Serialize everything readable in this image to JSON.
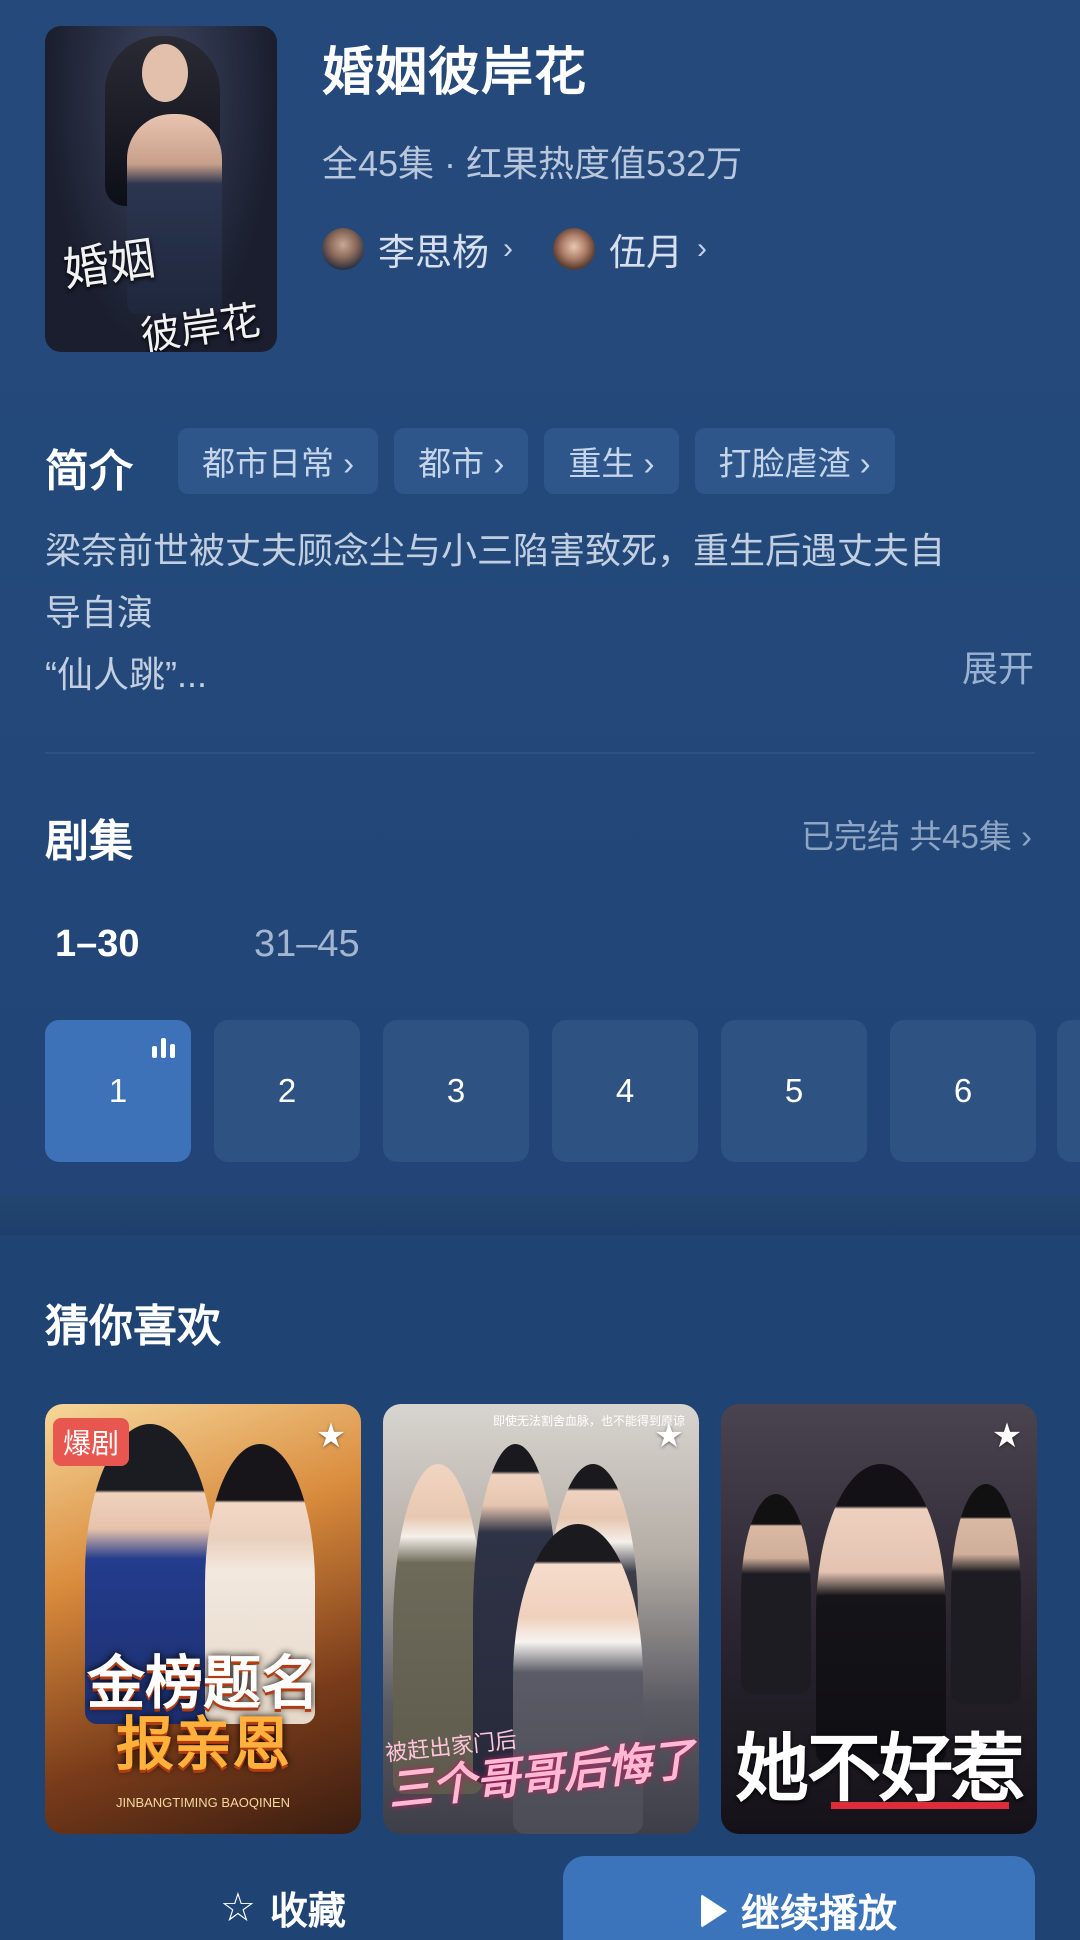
{
  "show": {
    "title": "婚姻彼岸花",
    "meta": "全45集 · 红果热度值532万",
    "poster_title_1": "婚姻",
    "poster_title_2": "彼岸花",
    "actors": [
      {
        "name": "李思杨",
        "chevron": "›"
      },
      {
        "name": "伍月",
        "chevron": "›"
      }
    ]
  },
  "intro": {
    "heading": "简介",
    "tags": [
      "都市日常 ›",
      "都市 ›",
      "重生 ›",
      "打脸虐渣 ›"
    ],
    "line1": "梁奈前世被丈夫顾念尘与小三陷害致死，重生后遇丈夫自",
    "line2": "导自演",
    "line3": "“仙人跳”...",
    "expand": "展开"
  },
  "episodes": {
    "heading": "剧集",
    "status": "已完结 共45集 ›",
    "ranges": [
      "1–30",
      "31–45"
    ],
    "items": [
      "1",
      "2",
      "3",
      "4",
      "5",
      "6"
    ],
    "playing_episode": "1"
  },
  "recommend": {
    "heading": "猜你喜欢",
    "cards": [
      {
        "badge": "爆剧",
        "title_1": "金榜题名",
        "title_2": "报亲恩",
        "subtitle": "JINBANGTIMING BAOQINEN",
        "icon": "star-icon"
      },
      {
        "top_text": "即使无法割舍血脉，也不能得到原谅",
        "title": "三个哥哥后悔了",
        "caption": "被赶出家门后",
        "icon": "star-icon"
      },
      {
        "title": "她不好惹",
        "icon": "star-icon"
      }
    ]
  },
  "bottom_bar": {
    "favorite_label": "收藏",
    "play_label": "继续播放"
  },
  "colors": {
    "background": "#1f4272",
    "accent": "#3c74bb",
    "chip": "#2e568a"
  }
}
